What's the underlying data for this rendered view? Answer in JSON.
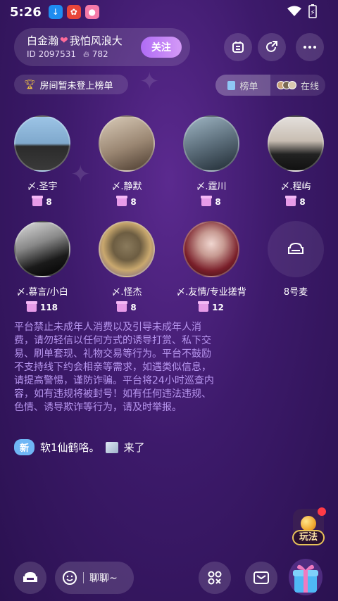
{
  "status_bar": {
    "time": "5:26",
    "battery_glyph": "⚡"
  },
  "room": {
    "name_part1": "白金瀚",
    "name_part2": "我怕风浪大",
    "id_label": "ID 2097531",
    "heat": "782",
    "follow_label": "关注"
  },
  "rank": {
    "status": "房间暂未登上榜单",
    "tab_rank": "榜单",
    "tab_online": "在线"
  },
  "seats": [
    {
      "name": "〆.圣宇",
      "gifts": "8"
    },
    {
      "name": "〆.静默",
      "gifts": "8"
    },
    {
      "name": "〆.霆川",
      "gifts": "8"
    },
    {
      "name": "〆.程屿",
      "gifts": "8"
    },
    {
      "name": "〆.慕言/小白",
      "gifts": "118"
    },
    {
      "name": "〆.怪杰",
      "gifts": "8"
    },
    {
      "name": "〆.友情/专业搓背",
      "gifts": "12"
    },
    {
      "name": "8号麦",
      "gifts": ""
    }
  ],
  "notice": "平台禁止未成年人消费以及引导未成年人消费，请勿轻信以任何方式的诱导打赏、私下交易、刷单套现、礼物交易等行为。平台不鼓励不支持线下约会相亲等需求，如遇类似信息，请提高警惕，谨防诈骗。平台将24小时巡查内容，如有违规将被封号！如有任何违法违规、色情、诱导欺诈等行为，请及时举报。",
  "join_message": {
    "badge": "新",
    "user": "软1仙鹤咯。",
    "action": "来了"
  },
  "play": {
    "label": "玩法"
  },
  "bottom": {
    "chat_placeholder": "聊聊~"
  },
  "colors": {
    "accent": "#b06cf5",
    "notice_text": "#b896f0",
    "new_badge": "#6fb6f5"
  }
}
